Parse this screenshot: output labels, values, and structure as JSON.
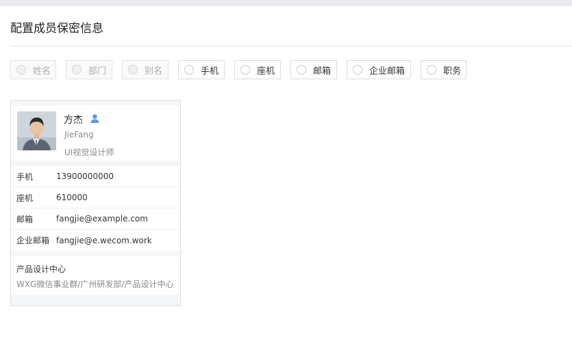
{
  "title": "配置成员保密信息",
  "options": [
    {
      "label": "姓名",
      "disabled": true
    },
    {
      "label": "部门",
      "disabled": true
    },
    {
      "label": "别名",
      "disabled": true
    },
    {
      "label": "手机",
      "disabled": false
    },
    {
      "label": "座机",
      "disabled": false
    },
    {
      "label": "邮箱",
      "disabled": false
    },
    {
      "label": "企业邮箱",
      "disabled": false
    },
    {
      "label": "职务",
      "disabled": false
    }
  ],
  "card": {
    "name": "方杰",
    "english_name": "JieFang",
    "position": "UI视觉设计师",
    "avatar_icon": "person-photo",
    "contact_icon": "person-icon",
    "rows": [
      {
        "key": "手机",
        "value": "13900000000"
      },
      {
        "key": "座机",
        "value": "610000"
      },
      {
        "key": "邮箱",
        "value": "fangjie@example.com"
      },
      {
        "key": "企业邮箱",
        "value": "fangjie@e.wecom.work"
      }
    ],
    "department": "产品设计中心",
    "department_path": "WXG微信事业群/广州研发部/产品设计中心"
  },
  "colors": {
    "accent": "#4a90e2",
    "border": "#d8dade",
    "panel": "#f5f6f8"
  }
}
